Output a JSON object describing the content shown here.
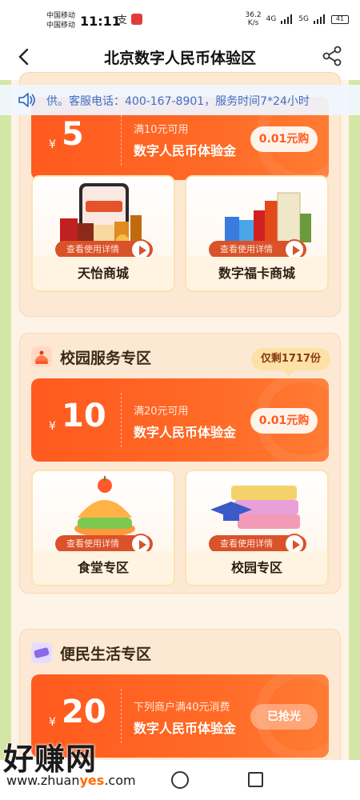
{
  "status_bar": {
    "carrier1": "中国移动",
    "carrier2": "中国移动",
    "time": "11:11",
    "speed": "36.2",
    "speed_unit": "K/s",
    "net1": "4G",
    "net2": "5G",
    "battery": "41"
  },
  "header": {
    "title": "北京数字人民币体验区",
    "back_icon": "chevron-left-icon",
    "share_icon": "share-icon"
  },
  "notice": {
    "icon": "speaker-icon",
    "text": "供。客服电话：400-167-8901，服务时间7*24小时"
  },
  "sections": [
    {
      "title": "",
      "coupon": {
        "currency": "¥",
        "amount": "5",
        "condition": "满10元可用",
        "name": "数字人民币体验金",
        "button": "0.01元购"
      },
      "stores": [
        {
          "detail": "查看使用详情",
          "name": "天怡商城"
        },
        {
          "detail": "查看使用详情",
          "name": "数字福卡商城"
        }
      ]
    },
    {
      "title": "校园服务专区",
      "badge": "仅剩1717份",
      "coupon": {
        "currency": "¥",
        "amount": "10",
        "condition": "满20元可用",
        "name": "数字人民币体验金",
        "button": "0.01元购"
      },
      "stores": [
        {
          "detail": "查看使用详情",
          "name": "食堂专区"
        },
        {
          "detail": "查看使用详情",
          "name": "校园专区"
        }
      ]
    },
    {
      "title": "便民生活专区",
      "coupon": {
        "currency": "¥",
        "amount": "20",
        "condition": "下列商户满40元消费",
        "name": "数字人民币体验金",
        "button": "已抢光"
      }
    }
  ],
  "watermark": {
    "title": "好赚网",
    "url_pre": "www.zhuan",
    "url_mid": "yes",
    "url_post": ".com"
  },
  "colors": {
    "coupon_orange": "#ff5a1f",
    "notice_blue": "#3f6fc6",
    "side_green": "#d4e6a6"
  }
}
